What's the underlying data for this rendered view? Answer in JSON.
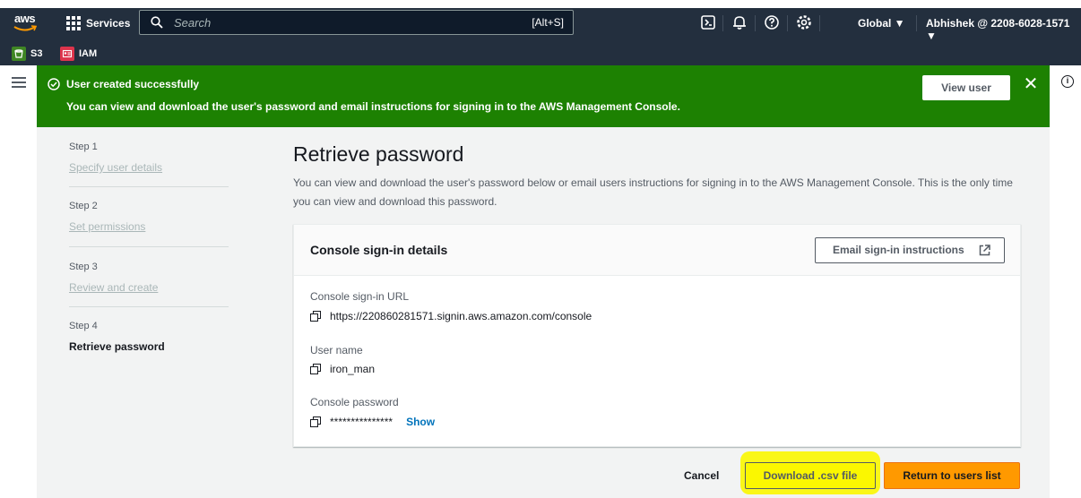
{
  "topnav": {
    "logo_text": "aws",
    "services_label": "Services",
    "search_placeholder": "Search",
    "search_shortcut": "[Alt+S]",
    "region": "Global ▼",
    "account": "Abhishek @ 2208-6028-1571 ▼",
    "icons": [
      "cloudshell-icon",
      "bell-icon",
      "help-icon",
      "settings-icon"
    ]
  },
  "favorites": [
    {
      "label": "S3",
      "color": "#3f8624"
    },
    {
      "label": "IAM",
      "color": "#dd344c"
    }
  ],
  "flash": {
    "title": "User created successfully",
    "message": "You can view and download the user's password and email instructions for signing in to the AWS Management Console.",
    "view_user_label": "View user",
    "close_symbol": "✕",
    "color": "#1d8102"
  },
  "steps": [
    {
      "num": "Step 1",
      "label": "Specify user details"
    },
    {
      "num": "Step 2",
      "label": "Set permissions"
    },
    {
      "num": "Step 3",
      "label": "Review and create"
    },
    {
      "num": "Step 4",
      "label": "Retrieve password"
    }
  ],
  "main": {
    "title": "Retrieve password",
    "description": "You can view and download the user's password below or email users instructions for signing in to the AWS Management Console. This is the only time you can view and download this password."
  },
  "card": {
    "title": "Console sign-in details",
    "email_button": "Email sign-in instructions",
    "fields": [
      {
        "label": "Console sign-in URL",
        "value": "https://220860281571.signin.aws.amazon.com/console"
      },
      {
        "label": "User name",
        "value": "iron_man"
      },
      {
        "label": "Console password",
        "value": "***************",
        "action": "Show"
      }
    ]
  },
  "footer": {
    "cancel": "Cancel",
    "download": "Download .csv file",
    "return": "Return to users list",
    "primary_color": "#ff9900",
    "highlight_color": "#fbf700"
  }
}
